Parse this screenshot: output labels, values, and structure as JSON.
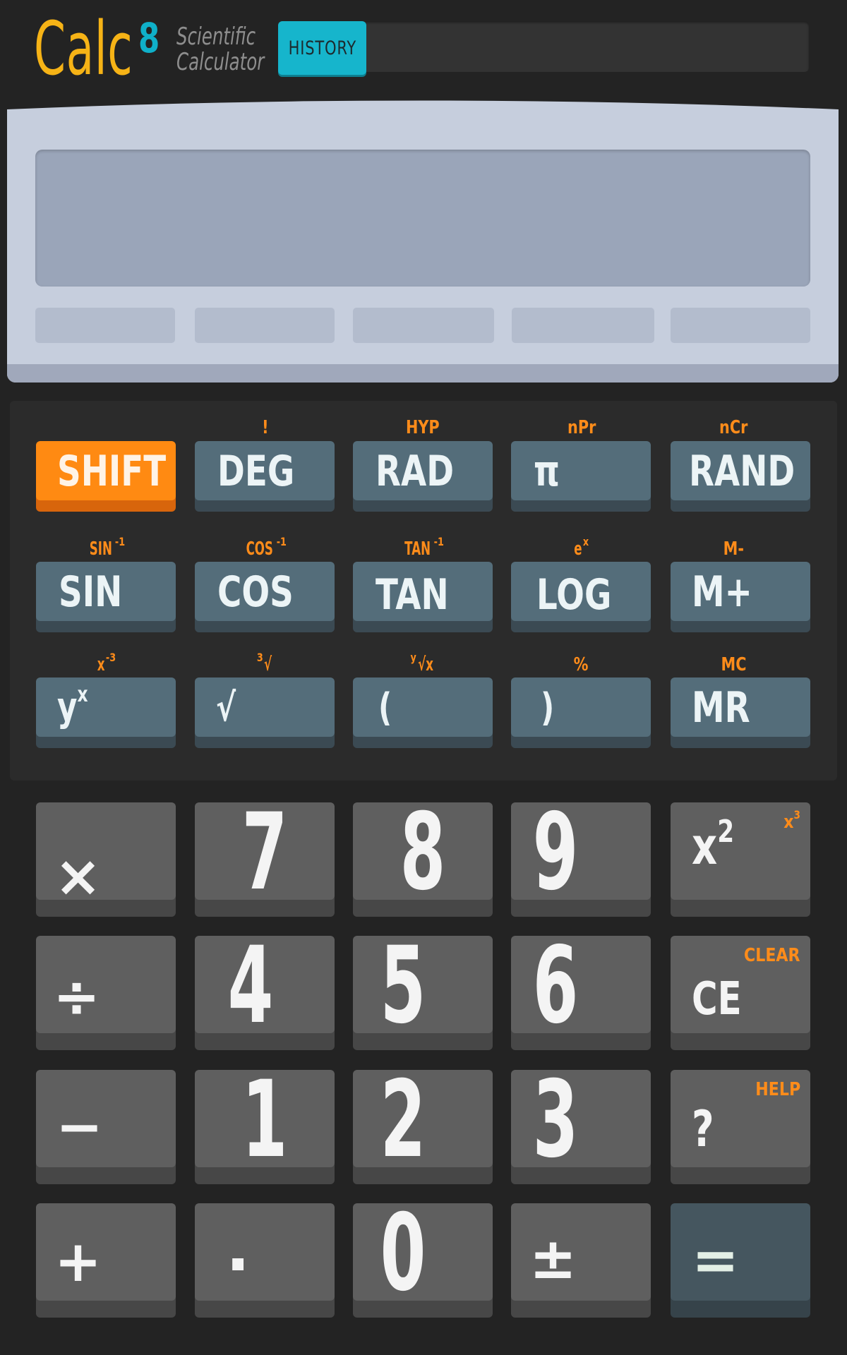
{
  "header": {
    "logo_text": "Calc",
    "logo_superscript": "8",
    "subtitle_line1": "Scientific",
    "subtitle_line2": "Calculator",
    "history_label": "HISTORY"
  },
  "colors": {
    "accent_yellow": "#f6b316",
    "accent_cyan": "#16b5cc",
    "shift_orange": "#ff8a12",
    "secondary_label": "#ff8c1a",
    "function_key": "#546d7a",
    "number_key": "#5f5f5f",
    "equals_key": "#45565f"
  },
  "function_keys": {
    "row1": [
      {
        "label": "SHIFT",
        "sub": ""
      },
      {
        "label": "DEG",
        "sub": "!"
      },
      {
        "label": "RAD",
        "sub": "HYP"
      },
      {
        "label": "π",
        "sub": "nPr"
      },
      {
        "label": "RAND",
        "sub": "nCr"
      }
    ],
    "row2": [
      {
        "label": "SIN",
        "sub": "SIN",
        "sub_sup": "-1"
      },
      {
        "label": "COS",
        "sub": "COS",
        "sub_sup": "-1"
      },
      {
        "label": "TAN",
        "sub": "TAN",
        "sub_sup": "-1"
      },
      {
        "label": "LOG",
        "sub": "e",
        "sub_sup": "x"
      },
      {
        "label": "M+",
        "sub": "M-"
      }
    ],
    "row3": [
      {
        "label": "y",
        "label_sup": "x",
        "sub": "x",
        "sub_sup": "-3"
      },
      {
        "label": "√",
        "sub": "√",
        "sub_pre": "3"
      },
      {
        "label": "(",
        "sub": "√x",
        "sub_pre": "y"
      },
      {
        "label": ")",
        "sub": "%"
      },
      {
        "label": "MR",
        "sub": "MC"
      }
    ]
  },
  "keypad": {
    "multiply": "×",
    "divide": "÷",
    "minus": "−",
    "plus": "+",
    "d7": "7",
    "d8": "8",
    "d9": "9",
    "d4": "4",
    "d5": "5",
    "d6": "6",
    "d1": "1",
    "d2": "2",
    "d3": "3",
    "dot": ".",
    "d0": "0",
    "plusminus": "±",
    "square": "x",
    "square_sup": "2",
    "square_alt": "x",
    "square_alt_sup": "3",
    "ce": "CE",
    "ce_alt": "CLEAR",
    "help": "?",
    "help_alt": "HELP",
    "equals": "="
  }
}
